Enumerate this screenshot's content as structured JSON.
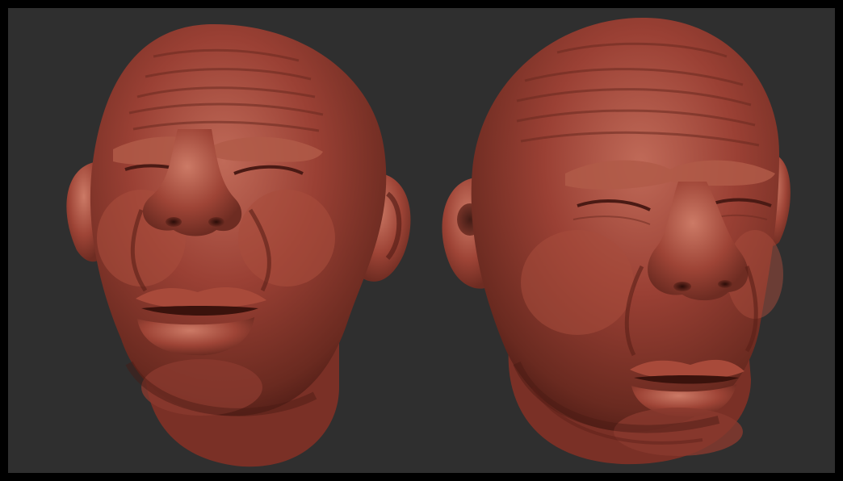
{
  "scene": {
    "frame_color": "#000000",
    "background_color": "#2f2f2f",
    "material": {
      "base_color": "#9a4034",
      "shadow_color": "#4a1a14",
      "highlight_color": "#c4705e"
    },
    "models": [
      {
        "name": "sculpted-head-front",
        "view": "front"
      },
      {
        "name": "sculpted-head-three-quarter",
        "view": "three-quarter"
      }
    ]
  }
}
